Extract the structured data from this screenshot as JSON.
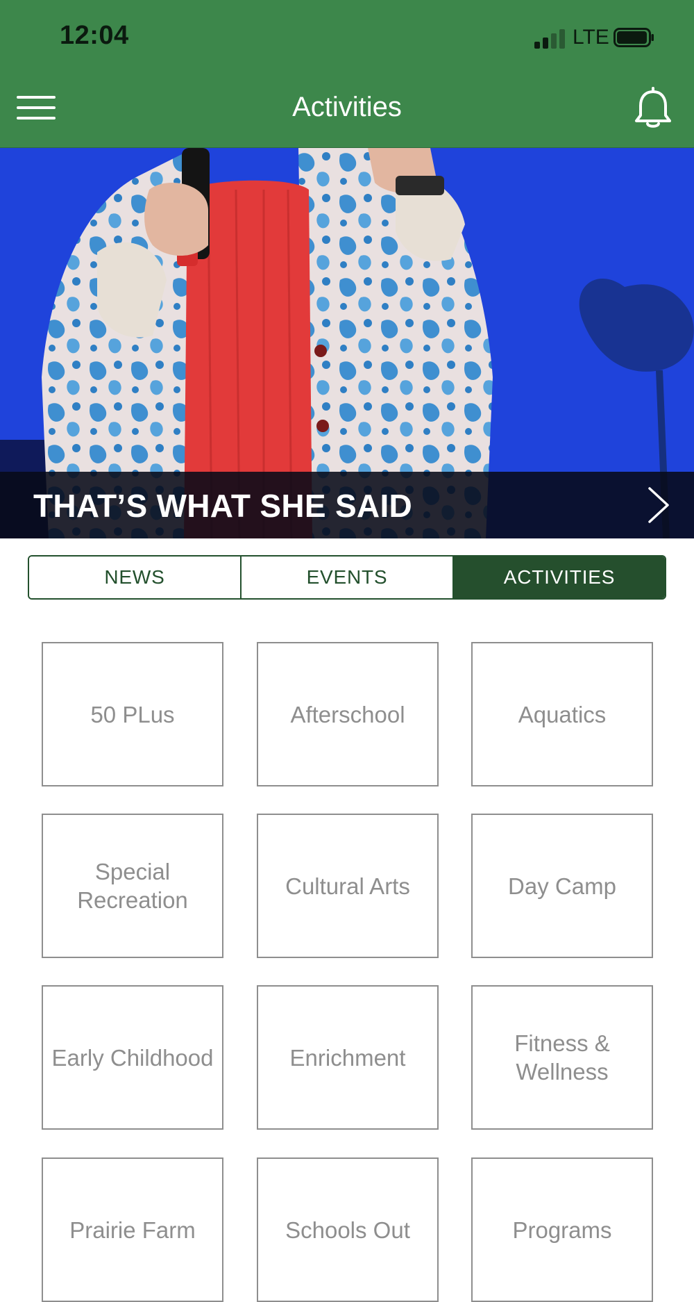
{
  "status_bar": {
    "time": "12:04",
    "network": "LTE",
    "signal_bars_filled": 2,
    "signal_bars_total": 4,
    "battery_level": 0.9
  },
  "header": {
    "title": "Activities",
    "menu_icon": "hamburger-menu-icon",
    "notification_icon": "bell-icon"
  },
  "hero": {
    "caption": "THAT’S WHAT SHE SAID",
    "arrow_icon": "chevron-right-icon"
  },
  "tabs": [
    {
      "label": "NEWS",
      "active": false
    },
    {
      "label": "EVENTS",
      "active": false
    },
    {
      "label": "ACTIVITIES",
      "active": true
    }
  ],
  "activities": [
    {
      "label": "50 PLus"
    },
    {
      "label": "Afterschool"
    },
    {
      "label": "Aquatics"
    },
    {
      "label": "Special Recreation"
    },
    {
      "label": "Cultural Arts"
    },
    {
      "label": "Day Camp"
    },
    {
      "label": "Early Childhood"
    },
    {
      "label": "Enrichment"
    },
    {
      "label": "Fitness & Wellness"
    },
    {
      "label": "Prairie Farm"
    },
    {
      "label": "Schools Out"
    },
    {
      "label": "Programs"
    }
  ],
  "colors": {
    "header_green": "#3d874b",
    "tab_dark_green": "#254f2d",
    "tile_border": "#8e8e8e",
    "hero_blue": "#1e41d8"
  }
}
